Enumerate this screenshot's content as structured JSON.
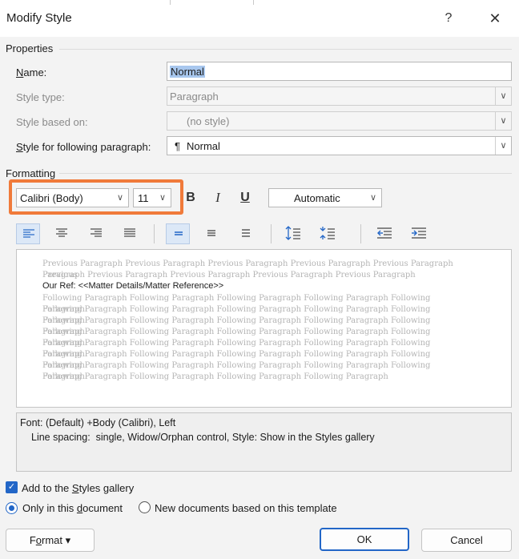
{
  "window": {
    "title": "Modify Style",
    "help_glyph": "?",
    "close_glyph": "✕"
  },
  "properties": {
    "section_label": "Properties",
    "name": {
      "label_accel": "N",
      "label_rest": "ame:",
      "value": "Normal"
    },
    "style_type": {
      "label": "Style type:",
      "value": "Paragraph"
    },
    "style_based_on": {
      "label": "Style based on:",
      "value": "(no style)"
    },
    "style_following": {
      "label_accel": "S",
      "label_rest": "tyle for following paragraph:",
      "value": "Normal",
      "icon": "paragraph-mark-icon"
    }
  },
  "formatting": {
    "section_label": "Formatting",
    "font": "Calibri (Body)",
    "size": "11",
    "bold": "B",
    "italic": "I",
    "underline": "U",
    "color": "Automatic",
    "highlight_color": "#f07a3a"
  },
  "toolbar": {
    "icons": [
      "align-left-icon",
      "align-center-icon",
      "align-right-icon",
      "justify-icon",
      "single-spacing-icon",
      "one-half-spacing-icon",
      "double-spacing-icon",
      "increase-paragraph-spacing-icon",
      "decrease-paragraph-spacing-icon",
      "decrease-indent-icon",
      "increase-indent-icon"
    ]
  },
  "preview": {
    "previous_lines": [
      "Previous Paragraph Previous Paragraph Previous Paragraph Previous Paragraph Previous Paragraph Previous",
      "Paragraph Previous Paragraph Previous Paragraph Previous Paragraph Previous Paragraph"
    ],
    "main_text": "Our Ref: <<Matter Details/Matter Reference>>",
    "following_lines": [
      "Following Paragraph Following Paragraph Following Paragraph Following Paragraph Following Paragraph",
      "Following Paragraph Following Paragraph Following Paragraph Following Paragraph Following Paragraph",
      "Following Paragraph Following Paragraph Following Paragraph Following Paragraph Following Paragraph",
      "Following Paragraph Following Paragraph Following Paragraph Following Paragraph Following Paragraph",
      "Following Paragraph Following Paragraph Following Paragraph Following Paragraph Following Paragraph",
      "Following Paragraph Following Paragraph Following Paragraph Following Paragraph Following Paragraph",
      "Following Paragraph Following Paragraph Following Paragraph Following Paragraph Following Paragraph",
      "Following Paragraph Following Paragraph Following Paragraph Following Paragraph"
    ]
  },
  "description": {
    "line1": "Font: (Default) +Body (Calibri), Left",
    "line2": "Line spacing:  single, Widow/Orphan control, Style: Show in the Styles gallery"
  },
  "options": {
    "add_gallery": {
      "pre": "Add to the ",
      "accel": "S",
      "post": "tyles gallery",
      "checked": true
    },
    "only_doc": {
      "pre": "Only in this ",
      "accel": "d",
      "post": "ocument",
      "selected": true
    },
    "new_docs": {
      "label": "New documents based on this template",
      "selected": false
    }
  },
  "buttons": {
    "format_pre": "F",
    "format_accel": "o",
    "format_post": "rmat",
    "format_caret": "▾",
    "ok": "OK",
    "cancel": "Cancel"
  }
}
